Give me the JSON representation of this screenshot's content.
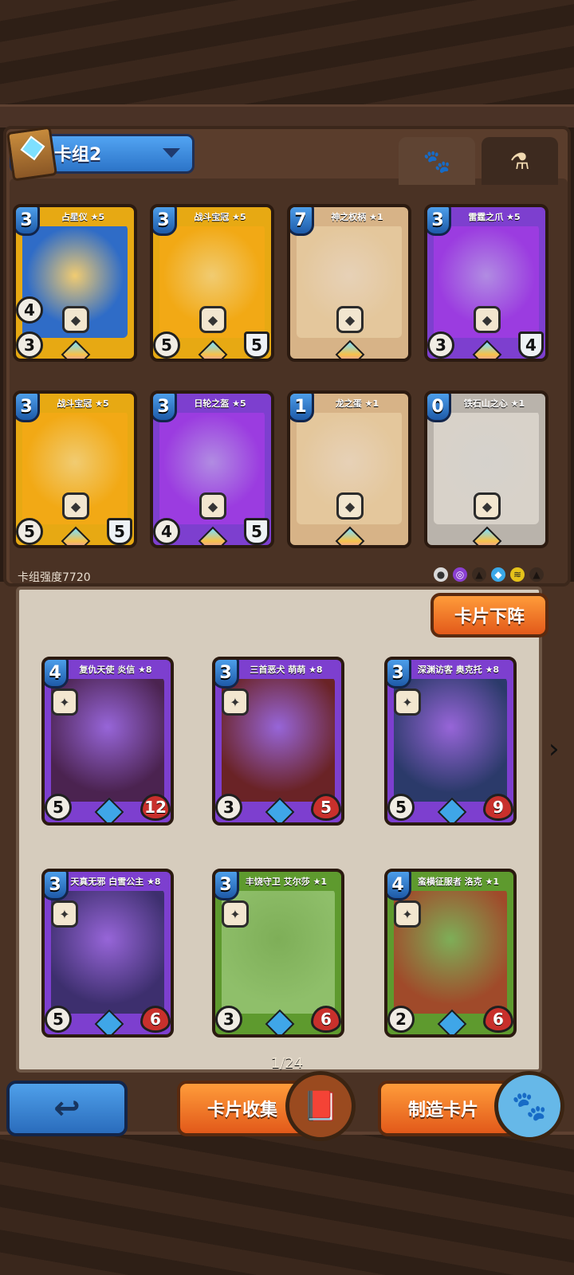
{
  "deck": {
    "selector_label": "卡组2",
    "tabs": [
      "paw-icon",
      "potion-icon"
    ],
    "strength_label": "卡组强度7720",
    "cards": [
      {
        "name": "占星仪 ★5",
        "cost": "3",
        "stat_left": "4",
        "stat_bottom_left": "3",
        "stat_bottom_right": "",
        "bg": "#e7a913",
        "art": "#2f6cc7"
      },
      {
        "name": "战斗宝冠 ★5",
        "cost": "3",
        "stat_left": "",
        "stat_bottom_left": "5",
        "stat_bottom_right": "5",
        "bg": "#e7a913",
        "art": "#f2a915"
      },
      {
        "name": "神之权柄 ★1",
        "cost": "7",
        "stat_left": "",
        "stat_bottom_left": "",
        "stat_bottom_right": "",
        "bg": "#d7b387",
        "art": "#e4c79c"
      },
      {
        "name": "雷霆之爪 ★5",
        "cost": "3",
        "stat_left": "",
        "stat_bottom_left": "3",
        "stat_bottom_right": "4",
        "bg": "#7d3fcf",
        "art": "#9b3ce0"
      },
      {
        "name": "战斗宝冠 ★5",
        "cost": "3",
        "stat_left": "",
        "stat_bottom_left": "5",
        "stat_bottom_right": "5",
        "bg": "#e7a913",
        "art": "#f2a915"
      },
      {
        "name": "日轮之盔 ★5",
        "cost": "3",
        "stat_left": "",
        "stat_bottom_left": "4",
        "stat_bottom_right": "5",
        "bg": "#7d3fcf",
        "art": "#9b3ce0"
      },
      {
        "name": "龙之蛋 ★1",
        "cost": "1",
        "stat_left": "",
        "stat_bottom_left": "",
        "stat_bottom_right": "",
        "bg": "#d7b387",
        "art": "#e4c79c"
      },
      {
        "name": "铁石山之心 ★1",
        "cost": "0",
        "stat_left": "",
        "stat_bottom_left": "",
        "stat_bottom_right": "",
        "bg": "#b9b3ab",
        "art": "#d8d2c9"
      }
    ]
  },
  "collection": {
    "remove_button": "卡片下阵",
    "page": "1/24",
    "cards": [
      {
        "name": "复仇天使 炎信 ★8",
        "cost": "4",
        "attack": "5",
        "health": "12",
        "bg": "#7d3fcf",
        "art": "#4b2350"
      },
      {
        "name": "三首恶犬 萌萌 ★8",
        "cost": "3",
        "attack": "3",
        "health": "5",
        "bg": "#7d3fcf",
        "art": "#6a2326"
      },
      {
        "name": "深渊访客 奥克托 ★8",
        "cost": "3",
        "attack": "5",
        "health": "9",
        "bg": "#7d3fcf",
        "art": "#2b3a6a"
      },
      {
        "name": "天真无邪 白雪公主 ★8",
        "cost": "3",
        "attack": "5",
        "health": "6",
        "bg": "#7d3fcf",
        "art": "#3d2f6e"
      },
      {
        "name": "丰饶守卫 艾尔莎 ★1",
        "cost": "3",
        "attack": "3",
        "health": "6",
        "bg": "#5e9a2e",
        "art": "#8fbf6a"
      },
      {
        "name": "蛮横征服者 洛克 ★1",
        "cost": "4",
        "attack": "2",
        "health": "6",
        "bg": "#5e9a2e",
        "art": "#a04a2a"
      }
    ]
  },
  "bottom": {
    "back_icon": "back-arrow-icon",
    "collect_label": "卡片收集",
    "craft_label": "制造卡片"
  }
}
